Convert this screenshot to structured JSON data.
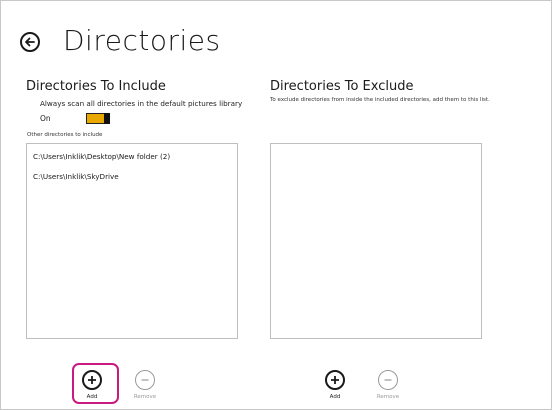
{
  "header": {
    "title": "Directories",
    "back_icon": "back-arrow-icon"
  },
  "include": {
    "heading": "Directories To Include",
    "scan_description": "Always scan all directories in the default pictures library",
    "toggle_label": "On",
    "toggle_state": "on",
    "toggle_color": "#e9a800",
    "other_label": "Other directories to include",
    "items": [
      "C:\\Users\\Inklik\\Desktop\\New folder (2)",
      "C:\\Users\\Inklik\\SkyDrive"
    ],
    "add_label": "Add",
    "remove_label": "Remove"
  },
  "exclude": {
    "heading": "Directories To Exclude",
    "description": "To exclude directories from inside the included directories, add them to this list.",
    "items": [],
    "add_label": "Add",
    "remove_label": "Remove"
  },
  "colors": {
    "highlight": "#c81a7f"
  },
  "icons": {
    "add": "plus-circle-icon",
    "remove": "minus-circle-icon"
  }
}
